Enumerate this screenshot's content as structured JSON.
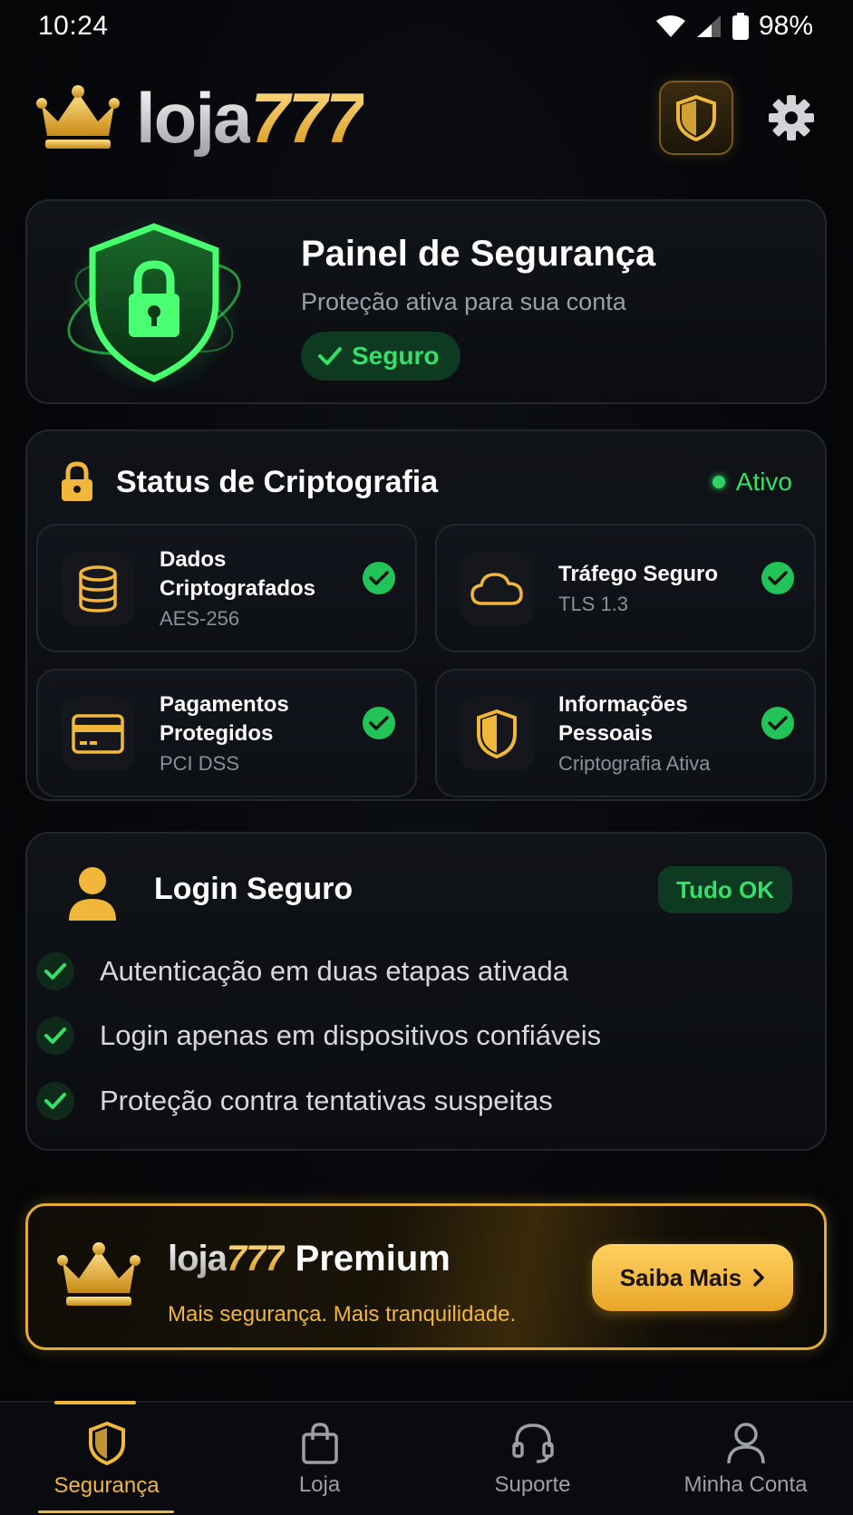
{
  "status_bar": {
    "time": "10:24",
    "battery": "98%"
  },
  "header": {
    "logo_part1": "loja",
    "logo_part2": "777"
  },
  "security_panel": {
    "title": "Painel de Segurança",
    "subtitle": "Proteção ativa para sua conta",
    "badge": "Seguro"
  },
  "crypto": {
    "title": "Status de Criptografia",
    "status": "Ativo",
    "items": [
      {
        "title": "Dados Criptografados",
        "subtitle": "AES-256",
        "icon": "database-icon"
      },
      {
        "title": "Tráfego Seguro",
        "subtitle": "TLS 1.3",
        "icon": "cloud-icon"
      },
      {
        "title": "Pagamentos Protegidos",
        "subtitle": "PCI DSS",
        "icon": "credit-card-icon"
      },
      {
        "title": "Informações Pessoais",
        "subtitle": "Criptografia Ativa",
        "icon": "shield-icon"
      }
    ]
  },
  "login": {
    "title": "Login Seguro",
    "badge": "Tudo OK",
    "items": [
      "Autenticação em duas etapas ativada",
      "Login apenas em dispositivos confiáveis",
      "Proteção contra tentativas suspeitas"
    ]
  },
  "premium": {
    "brand1": "loja",
    "brand2": "777",
    "title": "Premium",
    "subtitle": "Mais segurança. Mais tranquilidade.",
    "button": "Saiba Mais"
  },
  "nav": {
    "items": [
      {
        "label": "Segurança",
        "icon": "shield-icon"
      },
      {
        "label": "Loja",
        "icon": "shopping-bag-icon"
      },
      {
        "label": "Suporte",
        "icon": "headset-icon"
      },
      {
        "label": "Minha Conta",
        "icon": "user-icon"
      }
    ]
  },
  "colors": {
    "accent": "#f0b73a",
    "success": "#35e06a",
    "background": "#050608"
  }
}
